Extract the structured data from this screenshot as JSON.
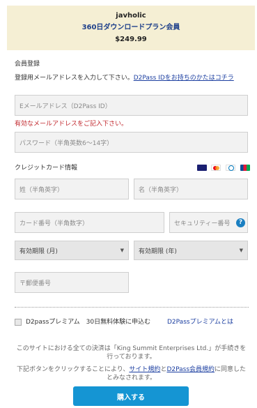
{
  "header": {
    "brand": "javholic",
    "plan": "360日ダウンロードプラン会員",
    "price": "$249.99"
  },
  "registration": {
    "title": "会員登録",
    "instruction": "登録用メールアドレスを入力して下さい。",
    "existing_link": "D2Pass IDをお持ちのかたはコチラ",
    "email_placeholder": "Eメールアドレス（D2Pass ID）",
    "email_error": "有効なメールアドレスをご記入下さい。",
    "password_placeholder": "パスワード（半角英数6〜14字）"
  },
  "credit_card": {
    "title": "クレジットカード情報",
    "card_brands": [
      "VISA",
      "MasterCard",
      "Diners",
      "JCB"
    ],
    "last_name_placeholder": "姓（半角英字）",
    "first_name_placeholder": "名（半角英字）",
    "card_number_placeholder": "カード番号（半角数字）",
    "security_code_placeholder": "セキュリティー番号",
    "help_label": "?",
    "exp_month": "有効期限 (月)",
    "exp_year": "有効期限 (年)",
    "postal_placeholder": "〒郵便番号"
  },
  "premium": {
    "checkbox_label": "D2passプレミアム　30日無料体験に申込む",
    "info_link": "D2Passプレミアムとは"
  },
  "notice": {
    "settlement": "このサイトにおける全ての決済は「King Summit Enterprises Ltd.」が手続きを行っております。",
    "agree_prefix": "下記ボタンをクリックすることにより、",
    "terms_link": "サイト規約",
    "and": "と",
    "member_terms_link": "D2Pass会員規約",
    "agree_suffix": "に同意したとみなされます。"
  },
  "submit_label": "購入する",
  "colors": {
    "header_bg": "#f5efd4",
    "link": "#1b3ea0",
    "error": "#c1272d",
    "button": "#1595d3"
  }
}
